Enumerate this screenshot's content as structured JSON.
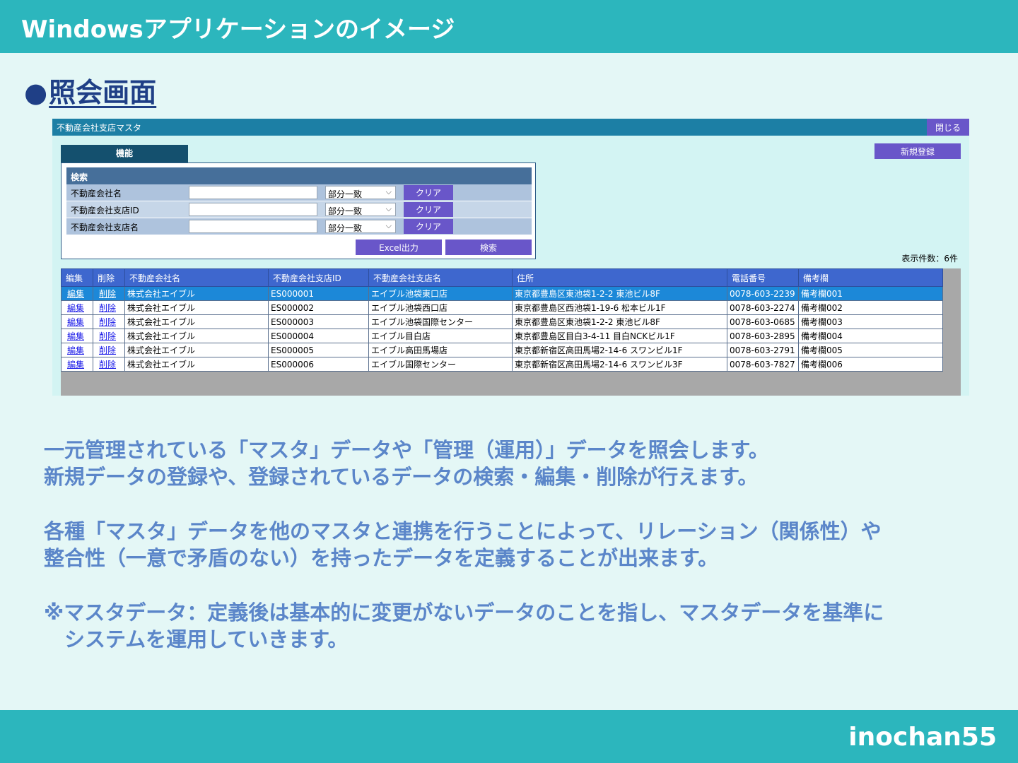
{
  "slide": {
    "title": "Windowsアプリケーションのイメージ",
    "section_bullet": "●",
    "section_heading": "照会画面",
    "footer_author": "inochan55"
  },
  "app": {
    "window_title": "不動産会社支店マスタ",
    "close_label": "閉じる",
    "function_tab": "機能",
    "new_register_label": "新規登録",
    "search": {
      "header": "検索",
      "rows": [
        {
          "label": "不動産会社名",
          "match": "部分一致",
          "clear": "クリア"
        },
        {
          "label": "不動産会社支店ID",
          "match": "部分一致",
          "clear": "クリア"
        },
        {
          "label": "不動産会社支店名",
          "match": "部分一致",
          "clear": "クリア"
        }
      ],
      "excel_label": "Excel出力",
      "search_label": "検索"
    },
    "result_count": "表示件数：6件",
    "table": {
      "headers": [
        "編集",
        "削除",
        "不動産会社名",
        "不動産会社支店ID",
        "不動産会社支店名",
        "住所",
        "電話番号",
        "備考欄"
      ],
      "edit_link": "編集",
      "delete_link": "削除",
      "rows": [
        {
          "company": "株式会社エイブル",
          "id": "ES000001",
          "branch": "エイブル池袋東口店",
          "address": "東京都豊島区東池袋1-2-2 東池ビル8F",
          "phone": "0078-603-2239",
          "note": "備考欄001"
        },
        {
          "company": "株式会社エイブル",
          "id": "ES000002",
          "branch": "エイブル池袋西口店",
          "address": "東京都豊島区西池袋1-19-6 松本ビル1F",
          "phone": "0078-603-2274",
          "note": "備考欄002"
        },
        {
          "company": "株式会社エイブル",
          "id": "ES000003",
          "branch": "エイブル池袋国際センター",
          "address": "東京都豊島区東池袋1-2-2 東池ビル8F",
          "phone": "0078-603-0685",
          "note": "備考欄003"
        },
        {
          "company": "株式会社エイブル",
          "id": "ES000004",
          "branch": "エイブル目白店",
          "address": "東京都豊島区目白3-4-11 目白NCKビル1F",
          "phone": "0078-603-2895",
          "note": "備考欄004"
        },
        {
          "company": "株式会社エイブル",
          "id": "ES000005",
          "branch": "エイブル高田馬場店",
          "address": "東京都新宿区高田馬場2-14-6 スワンビル1F",
          "phone": "0078-603-2791",
          "note": "備考欄005"
        },
        {
          "company": "株式会社エイブル",
          "id": "ES000006",
          "branch": "エイブル国際センター",
          "address": "東京都新宿区高田馬場2-14-6 スワンビル3F",
          "phone": "0078-603-7827",
          "note": "備考欄006"
        }
      ]
    }
  },
  "description": {
    "p1_line1": "一元管理されている「マスタ」データや「管理（運用）」データを照会します。",
    "p1_line2": "新規データの登録や、登録されているデータの検索・編集・削除が行えます。",
    "p2_line1": "各種「マスタ」データを他のマスタと連携を行うことによって、リレーション（関係性）や",
    "p2_line2": "整合性（一意で矛盾のない）を持ったデータを定義することが出来ます。",
    "p3_line1": "※マスタデータ：定義後は基本的に変更がないデータのことを指し、マスタデータを基準に",
    "p3_line2": "　システムを運用していきます。"
  },
  "colors": {
    "header_teal": "#2cb6bd",
    "background": "#e4f7f6",
    "heading_navy": "#1f3f86",
    "description_blue": "#5b86c9",
    "button_purple": "#6956c9",
    "selected_row": "#1c88d8"
  }
}
